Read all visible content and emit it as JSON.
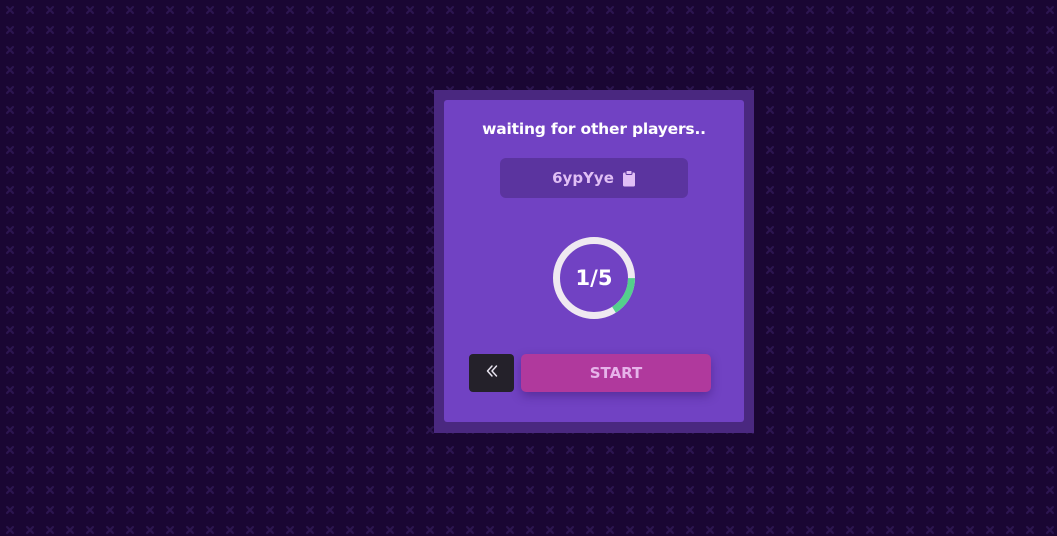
{
  "colors": {
    "background": "#1a0633",
    "pattern_mark": "#2c1550",
    "card_frame": "#4a2880",
    "card": "#7142c3",
    "code_box": "#5b349f",
    "ring_track": "#efe9f1",
    "ring_progress": "#54cf8c",
    "back_button": "#24212a",
    "start_button": "#b0399d",
    "start_text": "#e6b3ea",
    "code_text": "#e0bff5"
  },
  "lobby": {
    "title": "waiting for other players..",
    "room_code": "6ypYye",
    "copy_icon": "clipboard-icon",
    "players": {
      "label": "1/5",
      "current": 1,
      "max": 5
    },
    "back_icon": "double-chevron-left-icon",
    "start_label": "START"
  }
}
